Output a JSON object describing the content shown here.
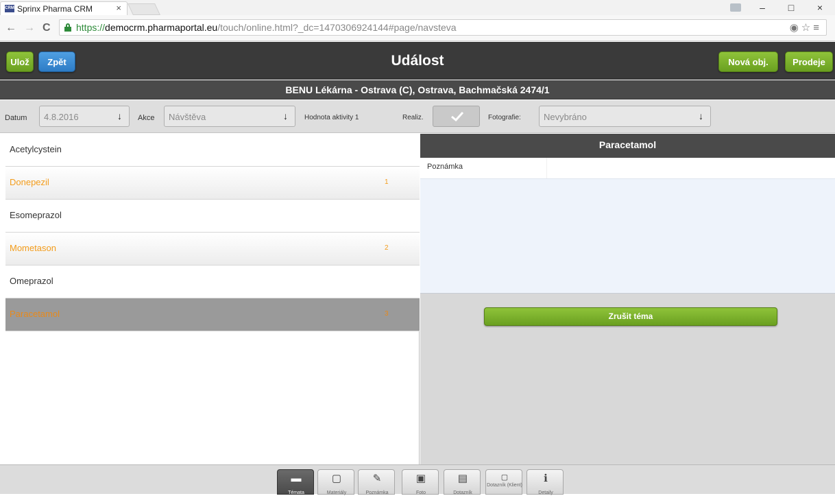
{
  "browser": {
    "tab_title": "Sprinx Pharma CRM",
    "tab_favicon_text": "CRM",
    "tab_close": "×",
    "url_scheme": "https://",
    "url_host": "democrm.pharmaportal.eu",
    "url_path": "/touch/online.html?_dc=1470306924144#page/navsteva",
    "icons": {
      "back": "←",
      "forward": "→",
      "reload": "C",
      "minimize": "–",
      "maximize": "□",
      "close": "×",
      "omnibox_right": "◉☆≡"
    }
  },
  "header": {
    "save_label": "Ulož",
    "back_label": "Zpět",
    "title": "Událost",
    "new_order_label": "Nová obj.",
    "sales_label": "Prodeje"
  },
  "subheader": {
    "location": "BENU Lékárna - Ostrava (C), Ostrava, Bachmačská 2474/1"
  },
  "filters": {
    "date_label": "Datum",
    "date_value": "4.8.2016",
    "action_label": "Akce",
    "action_value": "Návštěva",
    "activity_value_label": "Hodnota aktivity 1",
    "realized_label": "Realiz.",
    "photos_label": "Fotografie:",
    "photos_value": "Nevybráno",
    "dropdown_arrow": "↓"
  },
  "topics": [
    {
      "name": "Acetylcystein",
      "count": "",
      "style": "white"
    },
    {
      "name": "Donepezil",
      "count": "1",
      "style": "orange"
    },
    {
      "name": "Esomeprazol",
      "count": "",
      "style": "white"
    },
    {
      "name": "Mometason",
      "count": "2",
      "style": "orange"
    },
    {
      "name": "Omeprazol",
      "count": "",
      "style": "white"
    },
    {
      "name": "Paracetamol",
      "count": "3",
      "style": "active"
    }
  ],
  "detail": {
    "title": "Paracetamol",
    "note_label": "Poznámka",
    "note_value": "",
    "cancel_topic_label": "Zrušit téma"
  },
  "toolbar": {
    "items": [
      {
        "icon": "chat-icon",
        "glyph": "▬",
        "label": "Témata",
        "active": true
      },
      {
        "icon": "box-icon",
        "glyph": "▢",
        "label": "Materiály",
        "active": false
      },
      {
        "icon": "edit-icon",
        "glyph": "✎",
        "label": "Poznámka",
        "active": false
      },
      {
        "icon": "photo-icon",
        "glyph": "▣",
        "label": "Foto",
        "active": false
      },
      {
        "icon": "calendar-icon",
        "glyph": "▤",
        "label": "Dotazník",
        "active": false
      },
      {
        "icon": "questionnaire-icon",
        "glyph": "▢",
        "label": "Dotazník (Klient)",
        "active": false
      },
      {
        "icon": "info-icon",
        "glyph": "ℹ",
        "label": "Detaily",
        "active": false
      }
    ]
  },
  "colors": {
    "accent_green": "#7ab32e",
    "accent_blue": "#3a8fd8",
    "topic_orange": "#f39c1b",
    "header_dark": "#3a3a3a"
  }
}
